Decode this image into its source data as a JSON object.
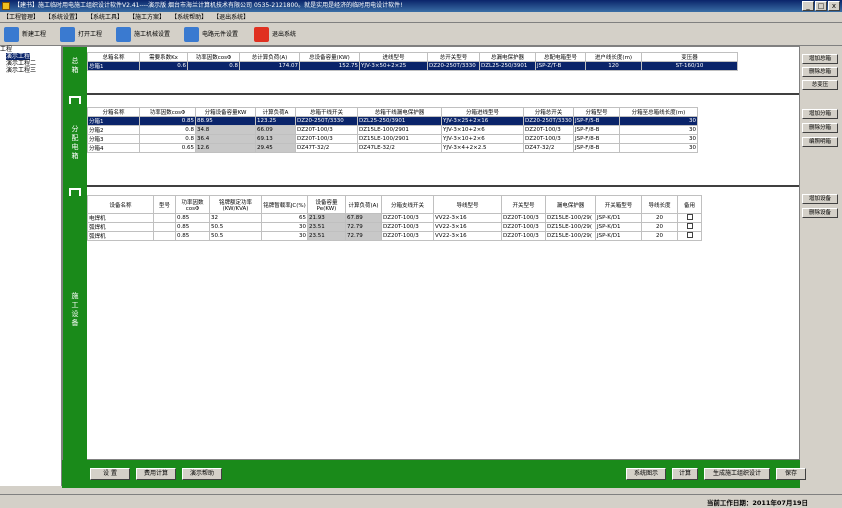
{
  "window": {
    "title": "【建书】施工临时用电施工组织设计软件V2.41----演示版 烟台市海兰计算机技术有限公司 0535-2121800。就是实用是经济的临时用电设计软件!",
    "minimize": "_",
    "maximize": "□",
    "close": "x"
  },
  "menu": [
    "【工程管理】",
    "【系统设置】",
    "【系统工具】",
    "【施工方案】",
    "【系统帮助】",
    "【退出系统】"
  ],
  "toolbar": {
    "new": "新建工程",
    "open": "打开工程",
    "machine": "施工机械设置",
    "component": "电路元件设置",
    "exit": "退出系统"
  },
  "tree": {
    "root": "工程",
    "items": [
      "演示工程",
      "演示工程二",
      "演示工程三"
    ]
  },
  "sections": {
    "main_box": "总箱",
    "dist_box": "分配电箱",
    "equipment": "施工设备"
  },
  "main_table": {
    "headers": [
      "总箱名称",
      "需要系数Kx",
      "功率因数cosΦ",
      "总计算负荷(A)",
      "总设备容量(KW)",
      "进线型号",
      "总开关型号",
      "总漏电保护器",
      "总配电箱型号",
      "进户线长度(m)",
      "变压器"
    ],
    "rows": [
      [
        "总箱1",
        "0.6",
        "0.8",
        "174.07",
        "152.75",
        "YJV-3×50+2×25",
        "DZ20-250T/3330",
        "DZL25-250/3901",
        "JSP-Z/T-B",
        "120",
        "ST-160/10"
      ]
    ]
  },
  "main_buttons": [
    "增加总箱",
    "删除总箱",
    "总变压"
  ],
  "dist_table": {
    "headers": [
      "分箱名称",
      "功率因数cosΦ",
      "分箱设备容量KW",
      "计算负荷A",
      "总箱干线开关",
      "总箱干线漏电保护器",
      "分箱进线型号",
      "分箱总开关",
      "分箱型号",
      "分箱至总箱线长度(m)"
    ],
    "rows": [
      [
        "分箱1",
        "0.85",
        "88.95",
        "123.25",
        "DZ20-250T/3330",
        "DZL25-250/3901",
        "YJV-3×25+2×16",
        "DZ20-250T/3330",
        "JSP-F/5-B",
        "30"
      ],
      [
        "分箱2",
        "0.8",
        "34.8",
        "66.09",
        "DZ20T-100/3",
        "DZ15LE-100/2901",
        "YJV-3×10+2×6",
        "DZ20T-100/3",
        "JSP-F/8-B",
        "30"
      ],
      [
        "分箱3",
        "0.8",
        "36.4",
        "69.13",
        "DZ20T-100/3",
        "DZ15LE-100/2901",
        "YJV-3×10+2×6",
        "DZ20T-100/3",
        "JSP-F/8-B",
        "30"
      ],
      [
        "分箱4",
        "0.65",
        "12.6",
        "29.45",
        "DZ47T-32/2",
        "DZ47LE-32/2",
        "YJV-3×4+2×2.5",
        "DZ47-32/2",
        "JSP-F/8-B",
        "30"
      ]
    ]
  },
  "dist_buttons": [
    "增加分箱",
    "删除分箱",
    "编照明箱"
  ],
  "equip_table": {
    "headers": [
      "设备名称",
      "型号",
      "功率因数cosΦ",
      "铭牌额定功率(KW/KVA)",
      "铭牌暂载率JC(%)",
      "设备容量Pe(KW)",
      "计算负荷(A)",
      "分箱支线开关",
      "导线型号",
      "开关型号",
      "漏电保护器",
      "开关箱型号",
      "导线长度",
      "备用"
    ],
    "rows": [
      [
        "电焊机",
        "",
        "0.85",
        "32",
        "65",
        "21.93",
        "67.89",
        "DZ20T-100/3",
        "VV22-3×16",
        "DZ20T-100/3",
        "DZ15LE-100/29(",
        "JSP-K/D1",
        "20",
        ""
      ],
      [
        "弧焊机",
        "",
        "0.85",
        "50.5",
        "30",
        "23.51",
        "72.79",
        "DZ20T-100/3",
        "VV22-3×16",
        "DZ20T-100/3",
        "DZ15LE-100/29(",
        "JSP-K/D1",
        "20",
        ""
      ],
      [
        "弧焊机",
        "",
        "0.85",
        "50.5",
        "30",
        "23.51",
        "72.79",
        "DZ20T-100/3",
        "VV22-3×16",
        "DZ20T-100/3",
        "DZ15LE-100/29(",
        "JSP-K/D1",
        "20",
        ""
      ]
    ]
  },
  "equip_buttons": [
    "增加设备",
    "删除设备"
  ],
  "bottom_left": [
    "设 置",
    "费用计算",
    "演示帮助"
  ],
  "bottom_right": [
    "系统图示",
    "计算",
    "生成施工组织设计",
    "保存"
  ],
  "status": "当前工作日期：2011年07月19日"
}
